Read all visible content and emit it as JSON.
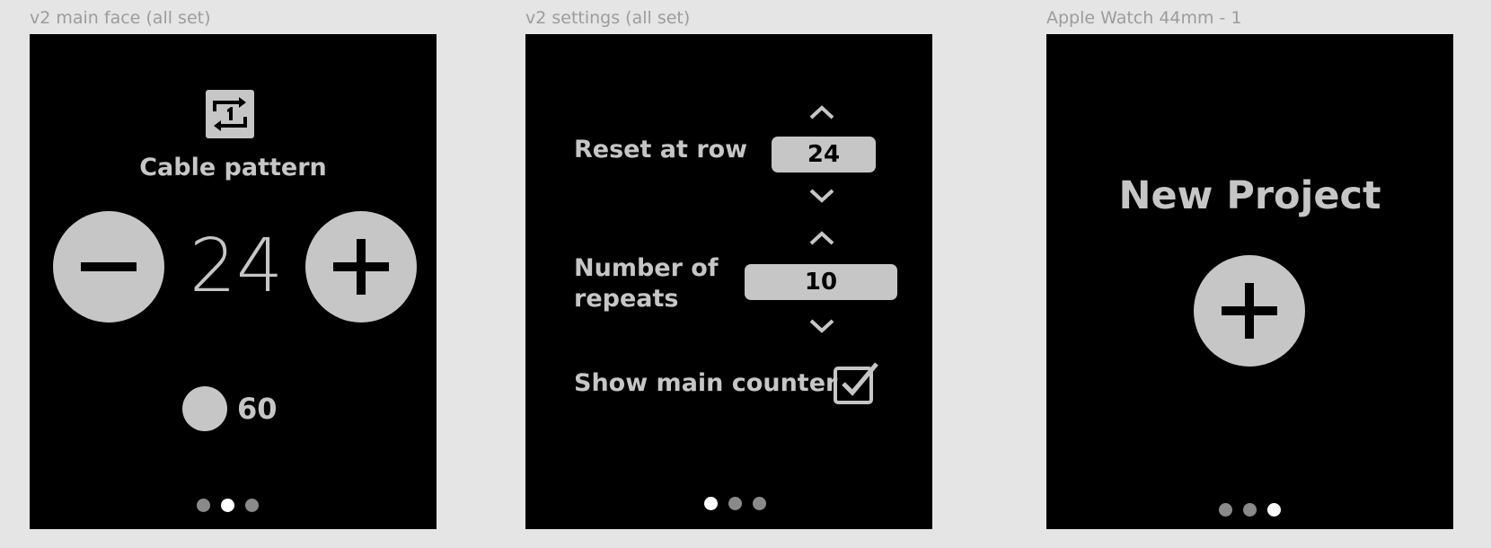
{
  "frames": [
    {
      "label": "v2 main face (all set)",
      "pattern_name": "Cable pattern",
      "counter_value": "24",
      "secondary_count": "60",
      "icons": {
        "top": "repeat-one-icon",
        "minus": "minus-icon",
        "plus": "plus-icon"
      },
      "pager": {
        "count": 3,
        "active_index": 1
      }
    },
    {
      "label": "v2 settings (all set)",
      "reset_label": "Reset at row",
      "reset_value": "24",
      "repeats_label_line1": "Number of",
      "repeats_label_line2": "repeats",
      "repeats_value": "10",
      "show_counter_label": "Show main counter",
      "show_counter_checked": true,
      "pager": {
        "count": 3,
        "active_index": 0
      }
    },
    {
      "label": "Apple Watch 44mm - 1",
      "title": "New Project",
      "icons": {
        "add": "plus-icon"
      },
      "pager": {
        "count": 3,
        "active_index": 2
      }
    }
  ],
  "colors": {
    "background": "#e5e5e5",
    "frame": "#000000",
    "element": "#c6c6c6",
    "dot_inactive": "#8a8a8a",
    "dot_active": "#ffffff"
  }
}
